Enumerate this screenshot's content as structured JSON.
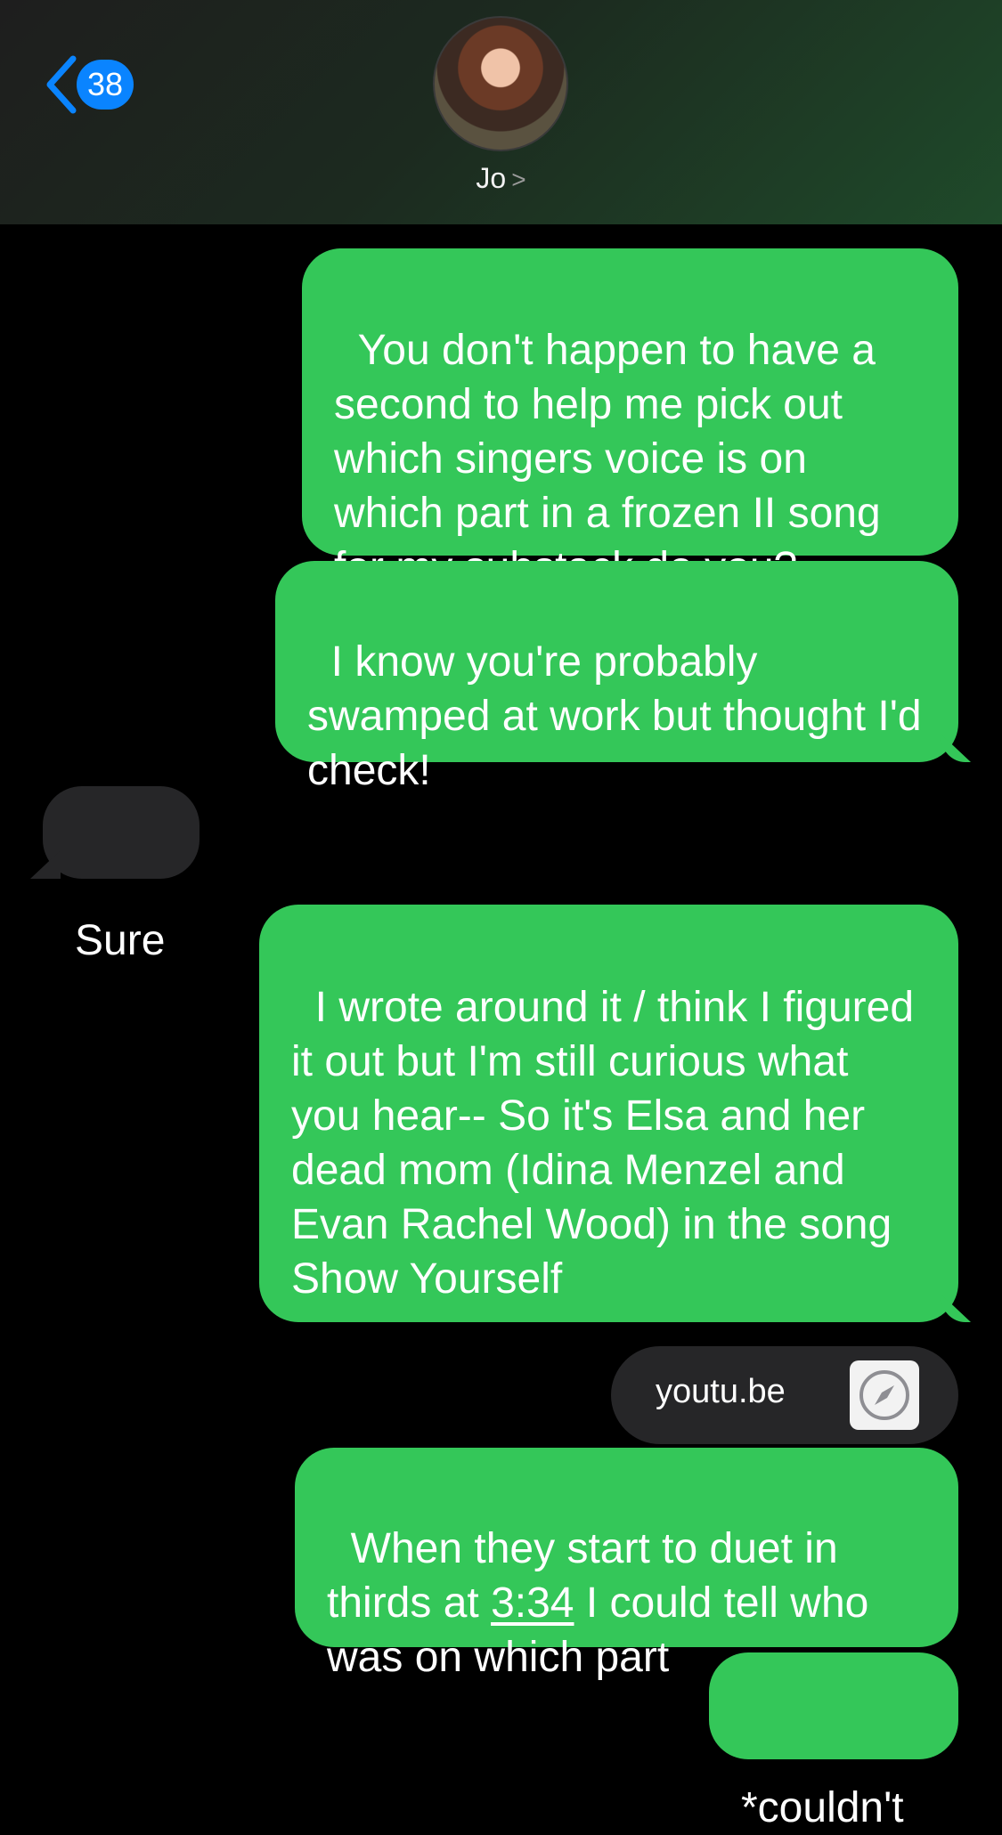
{
  "header": {
    "back_count": "38",
    "contact_name": "Jo",
    "contact_chevron": ">"
  },
  "messages": [
    {
      "from": "me",
      "text": "You don't happen to have a second to help me pick out which singers voice is on which part in a frozen II song for my substack do you?"
    },
    {
      "from": "me",
      "text": "I know you're probably swamped at work but thought I'd check!"
    },
    {
      "from": "them",
      "text": "Sure"
    },
    {
      "from": "me",
      "text": "I wrote around it / think I figured it out but I'm still curious what you hear-- So it's Elsa and her dead mom (Idina Menzel and Evan Rachel Wood) in the song Show Yourself"
    },
    {
      "from": "me",
      "link": "youtu.be"
    },
    {
      "from": "me",
      "text_before": "When they start to duet in thirds at ",
      "timestamp": "3:34",
      "text_after": " I could tell who was on which part"
    },
    {
      "from": "me",
      "text": "*couldn't"
    }
  ],
  "colors": {
    "outgoing": "#34c759",
    "incoming": "#262628",
    "badge": "#0a84ff"
  },
  "icons": {
    "back": "chevron-left-icon",
    "link": "safari-compass-icon"
  }
}
